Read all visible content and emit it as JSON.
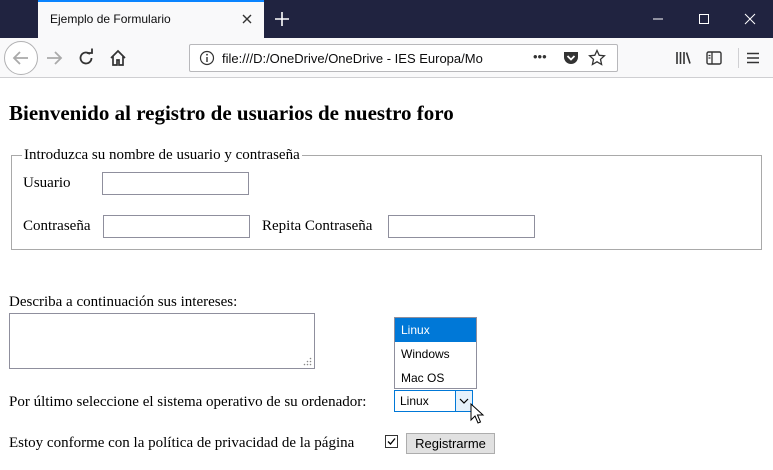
{
  "browser": {
    "tab_title": "Ejemplo de Formulario",
    "url": "file:///D:/OneDrive/OneDrive - IES Europa/Mo",
    "page_actions": "•••"
  },
  "page": {
    "heading": "Bienvenido al registro de usuarios de nuestro foro",
    "fieldset_legend": "Introduzca su nombre de usuario y contraseña",
    "usuario_label": "Usuario",
    "usuario_value": "",
    "password_label": "Contraseña",
    "password_value": "",
    "repeat_password_label": "Repita Contraseña",
    "repeat_password_value": "",
    "interests_label": "Describa a continuación sus intereses:",
    "interests_value": "",
    "os_label": "Por último seleccione el sistema operativo de su ordenador:",
    "os_selected": "Linux",
    "os_options": [
      "Linux",
      "Windows",
      "Mac OS"
    ],
    "privacy_label": "Estoy conforme con la política de privacidad de la página",
    "privacy_checked": true,
    "submit_label": "Registrarme"
  },
  "colors": {
    "titlebar": "#202340",
    "accent": "#0078d7",
    "tab_highlight": "#0a84ff"
  }
}
